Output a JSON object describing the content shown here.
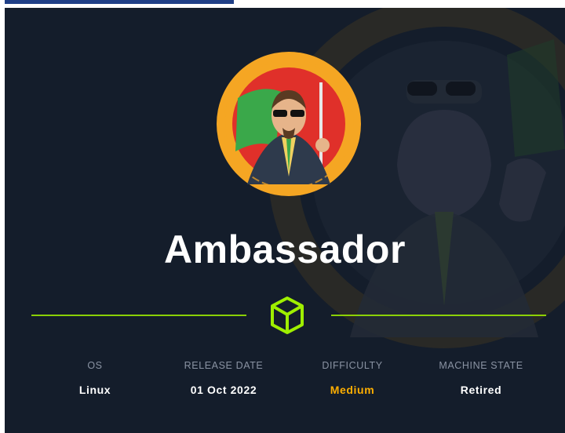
{
  "machine": {
    "name": "Ambassador"
  },
  "stats": [
    {
      "label": "OS",
      "value": "Linux"
    },
    {
      "label": "RELEASE DATE",
      "value": "01 Oct 2022"
    },
    {
      "label": "DIFFICULTY",
      "value": "Medium"
    },
    {
      "label": "MACHINE STATE",
      "value": "Retired"
    }
  ],
  "colors": {
    "background": "#141d2b",
    "accent_green": "#9fef00",
    "difficulty_medium": "#ffaf00",
    "avatar_ring": "#f5a623"
  },
  "icons": {
    "cube": "cube-icon",
    "avatar": "ambassador-avatar"
  }
}
